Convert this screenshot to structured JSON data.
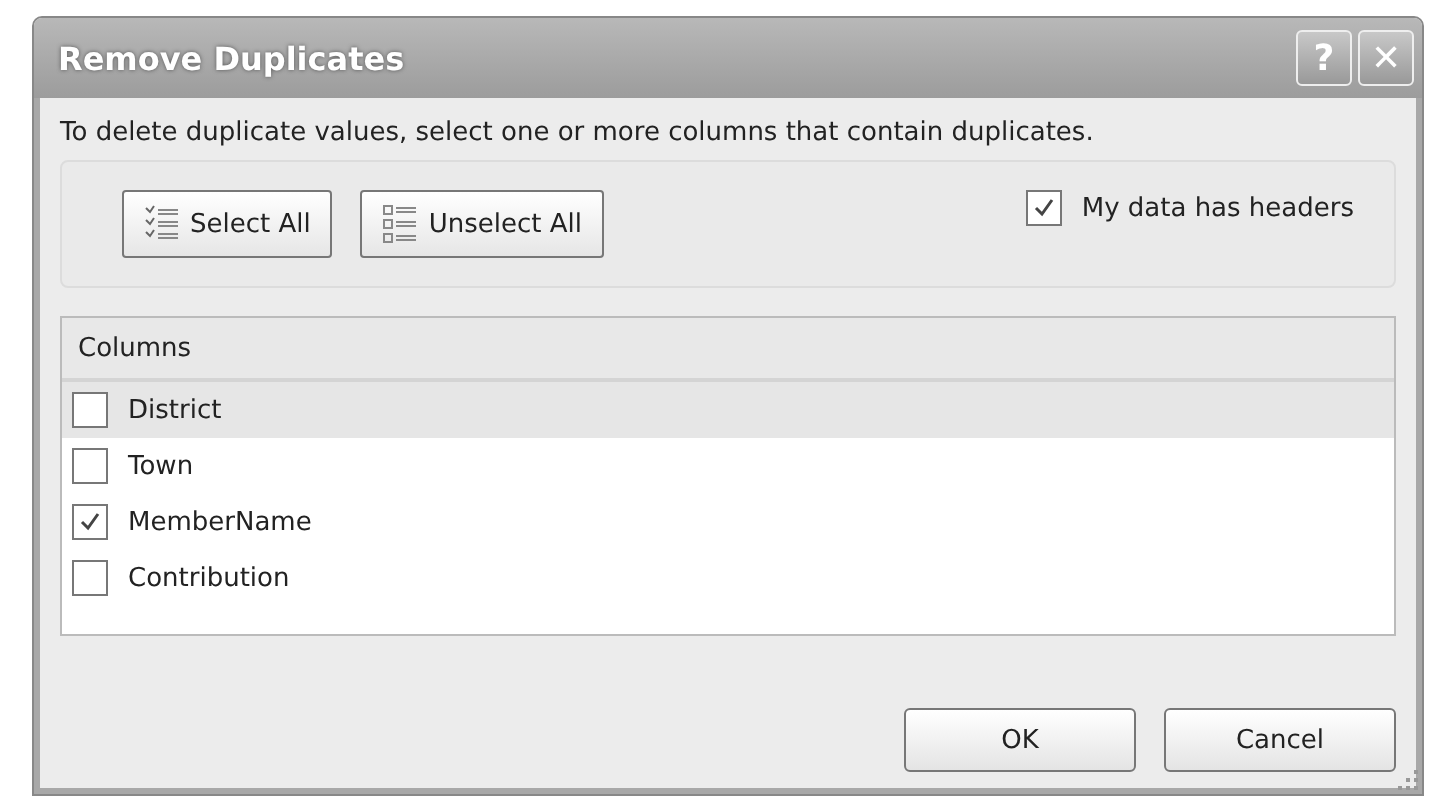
{
  "window": {
    "title": "Remove Duplicates",
    "help_button": "?",
    "close_button": "✕"
  },
  "instruction": "To delete duplicate values, select one or more columns that contain duplicates.",
  "toolbar": {
    "buttons": [
      {
        "kind": "select",
        "label": "Select All"
      },
      {
        "kind": "unselect",
        "label": "Unselect All"
      }
    ],
    "headers_option": {
      "label": "My data has headers",
      "checked": true
    }
  },
  "columns_list": {
    "header": "Columns",
    "items": [
      {
        "label": "District",
        "checked": false,
        "selected": true
      },
      {
        "label": "Town",
        "checked": false,
        "selected": false
      },
      {
        "label": "MemberName",
        "checked": true,
        "selected": false
      },
      {
        "label": "Contribution",
        "checked": false,
        "selected": false
      }
    ]
  },
  "buttons": [
    "OK",
    "Cancel"
  ]
}
